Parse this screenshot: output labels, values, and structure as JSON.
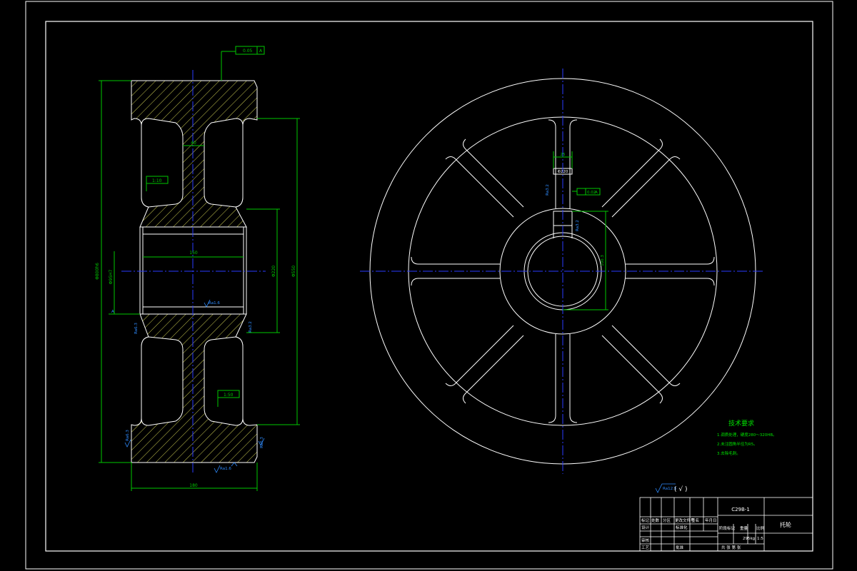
{
  "drawing": {
    "part_code": "C29B-1",
    "part_name": "托轮",
    "colors": {
      "outline": "#ffffff",
      "dimension": "#00c800",
      "centerline": "#2a3cff",
      "annotation": "#2f8cff",
      "hatch": "#ffff66",
      "background": "#000000"
    }
  },
  "section_view": {
    "dim_outer_dia": "Φ800h6",
    "dim_rim_inner_dia": "Φ550",
    "dim_hub_dia": "Φ220",
    "dim_bore_dia": "Φ95H7",
    "dim_width": "180",
    "dim_hub_length": "150",
    "dim_web_thickness": "40",
    "tol_top_runout": "0.05",
    "tol_top_datum": "A",
    "tol_web_left": "1:10",
    "tol_web_right": "1:50",
    "rough_bore": "Ra1.6",
    "rough_left_face": "Ra6.3",
    "rough_bottom": "Ra1.6",
    "rough_rim_left": "Ra6.3",
    "rough_rim_right": "Ra6.3",
    "rough_hub_right": "Ra3.2",
    "datum_label": "A"
  },
  "front_view": {
    "dim_key_width": "25",
    "dim_keyway_depth": "100.3",
    "dim_hub_radius": "Φ220",
    "rough_keyway": "Ra3.2",
    "rough_key_side": "Ra3.2",
    "tol_keyway_sym": "0.02",
    "tol_keyway_datum": "A"
  },
  "tech_requirements": {
    "title": "技术要求",
    "items": [
      "1.调质处理，硬度280～320HB。",
      "2.未注圆角半径为R5。",
      "3.去除毛刺。"
    ]
  },
  "roughness_note": {
    "value": "Ra12.5",
    "suffix": "( √ )"
  },
  "title_block": {
    "row_headers": [
      "标记",
      "处数",
      "分区",
      "更改文件号",
      "签名",
      "年月日"
    ],
    "designer_label": "设计",
    "standardize_label": "标准化",
    "reviewer_label": "审核",
    "process_label": "工艺",
    "approve_label": "批准",
    "stage_label": "阶段标记",
    "weight_label": "重量",
    "scale_label": "比例",
    "weight_value": "295kg",
    "scale_value": "1:5",
    "sheets_label": "共  张  第  张"
  }
}
